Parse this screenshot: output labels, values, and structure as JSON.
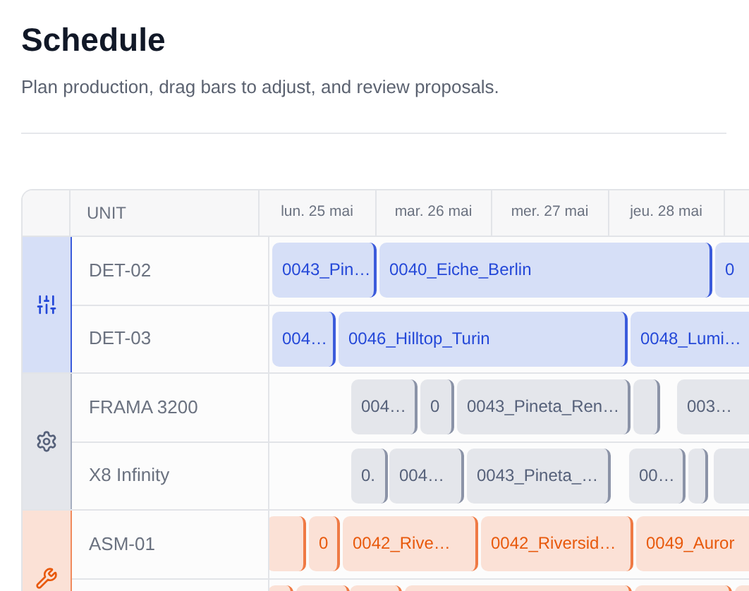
{
  "header": {
    "title": "Schedule",
    "subtitle": "Plan production, drag bars to adjust, and review proposals."
  },
  "table": {
    "unit_heading": "UNIT",
    "days": [
      "lun. 25 mai",
      "mar. 26 mai",
      "mer. 27 mai",
      "jeu. 28 mai"
    ],
    "groups": [
      {
        "kind": "sliders",
        "rows": [
          {
            "unit": "DET-02",
            "bars": [
              {
                "kind": "labeled",
                "label": "0043_Pin…"
              },
              {
                "kind": "labeled",
                "label": "0040_Eiche_Berlin"
              },
              {
                "kind": "labeled",
                "label": "0"
              }
            ]
          },
          {
            "unit": "DET-03",
            "bars": [
              {
                "kind": "labeled",
                "label": "004…"
              },
              {
                "kind": "labeled",
                "label": "0046_Hilltop_Turin"
              },
              {
                "kind": "labeled",
                "label": "0048_Lumi…"
              }
            ]
          }
        ]
      },
      {
        "kind": "gear",
        "rows": [
          {
            "unit": "FRAMA 3200",
            "bars": [
              {
                "kind": "labeled",
                "label": "004…"
              },
              {
                "kind": "labeled",
                "label": "0"
              },
              {
                "kind": "labeled",
                "label": "0043_Pineta_Ren…"
              },
              {
                "kind": "blank"
              },
              {
                "kind": "labeled",
                "label": "003…"
              }
            ]
          },
          {
            "unit": "X8 Infinity",
            "bars": [
              {
                "kind": "labeled",
                "label": "0."
              },
              {
                "kind": "labeled",
                "label": "004…"
              },
              {
                "kind": "labeled",
                "label": "0043_Pineta_…"
              },
              {
                "kind": "labeled",
                "label": "00…"
              },
              {
                "kind": "blank"
              },
              {
                "kind": "blank"
              }
            ]
          }
        ]
      },
      {
        "kind": "wrench",
        "rows": [
          {
            "unit": "ASM-01",
            "bars": [
              {
                "kind": "blank"
              },
              {
                "kind": "labeled",
                "label": "0"
              },
              {
                "kind": "labeled",
                "label": "0042_Rive…"
              },
              {
                "kind": "labeled",
                "label": "0042_Riversid…"
              },
              {
                "kind": "labeled",
                "label": "0049_Auror"
              }
            ]
          },
          {
            "bars": [
              {
                "kind": "blank"
              },
              {
                "kind": "blank"
              },
              {
                "kind": "blank"
              },
              {
                "kind": "blank"
              },
              {
                "kind": "blank"
              },
              {
                "kind": "blank"
              }
            ]
          }
        ]
      }
    ]
  }
}
